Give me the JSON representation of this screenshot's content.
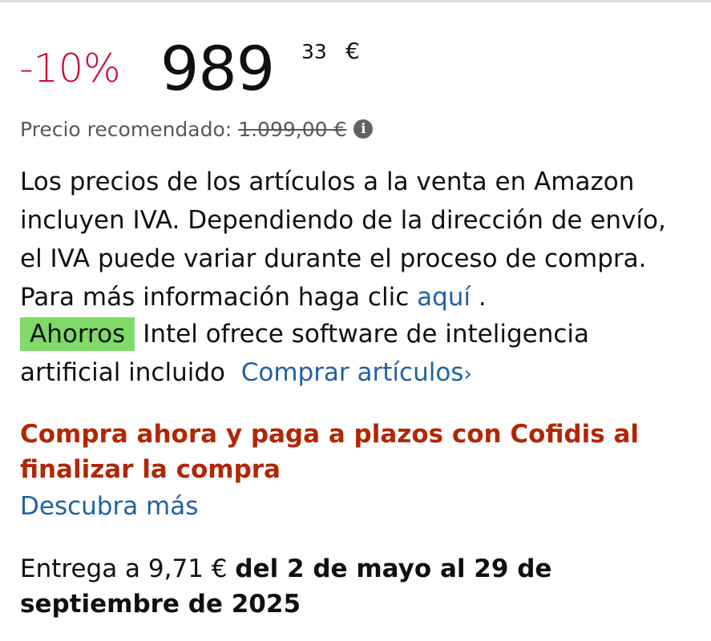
{
  "price": {
    "discount": "-10%",
    "whole": "989",
    "fraction": "33",
    "currency": "€"
  },
  "rrp": {
    "label": "Precio recomendado:",
    "value": "1.099,00 €",
    "icon": "info-icon"
  },
  "tax_notice": {
    "text": "Los precios de los artículos a la venta en Amazon incluyen IVA. Dependiendo de la dirección de envío, el IVA puede variar durante el proceso de compra. Para más información haga clic",
    "link_label": "aquí",
    "trailing": "."
  },
  "savings": {
    "badge": "Ahorros",
    "text": "Intel ofrece software de inteligencia artificial incluido",
    "link_label": "Comprar artículos",
    "chevron": "›"
  },
  "financing": {
    "headline": "Compra ahora y paga a plazos con Cofidis al finalizar la compra",
    "link_label": "Descubra más"
  },
  "delivery": {
    "prefix": "Entrega a 9,71 €",
    "dates": "del 2 de mayo al 29 de septiembre de 2025"
  },
  "colors": {
    "discount": "#cc0c39",
    "link": "#2162a1",
    "badge_bg": "#7fda69",
    "promo_text": "#b12704"
  }
}
